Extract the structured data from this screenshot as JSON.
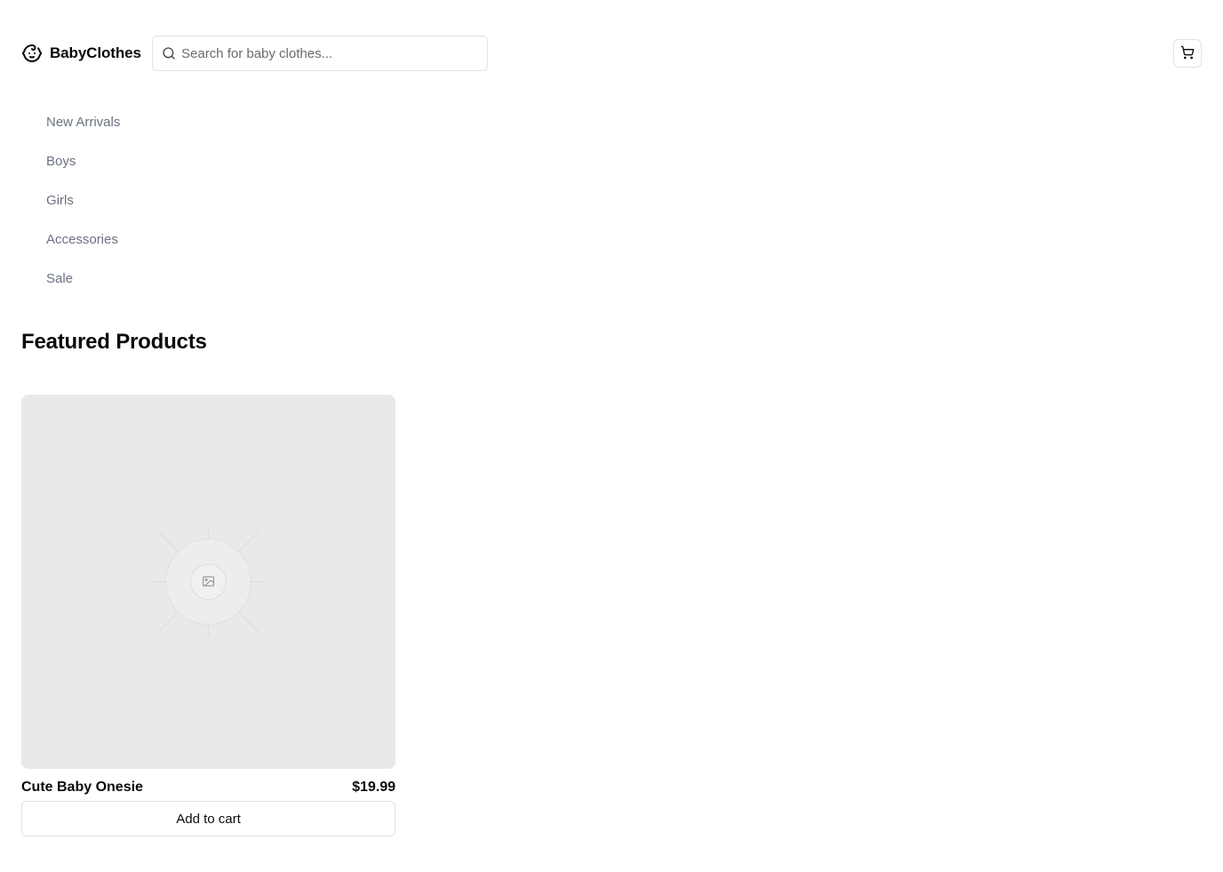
{
  "brand": {
    "name": "BabyClothes",
    "icon": "baby-face-icon"
  },
  "search": {
    "placeholder": "Search for baby clothes...",
    "value": "",
    "icon": "search-icon"
  },
  "header": {
    "cart_icon": "shopping-cart-icon"
  },
  "nav": {
    "items": [
      {
        "label": "New Arrivals"
      },
      {
        "label": "Boys"
      },
      {
        "label": "Girls"
      },
      {
        "label": "Accessories"
      },
      {
        "label": "Sale"
      }
    ]
  },
  "featured": {
    "title": "Featured Products",
    "products": [
      {
        "name": "Cute Baby Onesie",
        "price": "$19.99",
        "button_label": "Add to cart",
        "image_icon": "image-placeholder-icon"
      }
    ]
  },
  "colors": {
    "text": "#0a0a0a",
    "muted": "#6b7280",
    "border": "#e2e2e2",
    "image_bg": "#e9e9e9"
  }
}
